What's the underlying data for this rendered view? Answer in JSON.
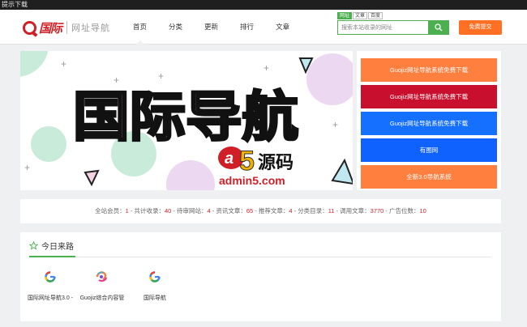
{
  "topbar": {
    "text": "提示下载"
  },
  "logo": {
    "name": "国际",
    "subtitle": "网址导航"
  },
  "nav": [
    {
      "label": "首页",
      "active": true
    },
    {
      "label": "分类"
    },
    {
      "label": "更新"
    },
    {
      "label": "排行"
    },
    {
      "label": "文章"
    }
  ],
  "search": {
    "tabs": [
      {
        "label": "网址",
        "active": true
      },
      {
        "label": "文章"
      },
      {
        "label": "百度"
      }
    ],
    "placeholder": "搜索本站收录的网址",
    "icon": "search-icon"
  },
  "submit_label": "免费提交",
  "banner": {
    "heading": "国际导航",
    "watermark_brand": "源码",
    "watermark_site": "admin5.com"
  },
  "ads": [
    {
      "label": "Guojiz网址导航系统免费下载",
      "color": "#ff7f3f"
    },
    {
      "label": "Guojiz网址导航系统免费下载",
      "color": "#c8102e"
    },
    {
      "label": "Guojiz网址导航系统免费下载",
      "color": "#1670ff"
    },
    {
      "label": "有图网",
      "color": "#0f62fe"
    },
    {
      "label": "全新3.0导航系统",
      "color": "#ff7f3f"
    }
  ],
  "stats": [
    {
      "label": "全站会员：",
      "value": "1"
    },
    {
      "label": "共计收录：",
      "value": "40"
    },
    {
      "label": "待审网站：",
      "value": "4"
    },
    {
      "label": "资讯文章：",
      "value": "65"
    },
    {
      "label": "推荐文章：",
      "value": "4"
    },
    {
      "label": "分类目录：",
      "value": "11"
    },
    {
      "label": "调用文章：",
      "value": "3770"
    },
    {
      "label": "广告位数：",
      "value": "10"
    }
  ],
  "today": {
    "title": "今日来路",
    "icon": "star-icon",
    "sites": [
      {
        "label": "国际网址导航3.0 -",
        "icon": "google-g-icon"
      },
      {
        "label": "Guojiz综合内容管",
        "icon": "colorful-logo-icon"
      },
      {
        "label": "国际导航",
        "icon": "google-g-icon"
      }
    ]
  }
}
